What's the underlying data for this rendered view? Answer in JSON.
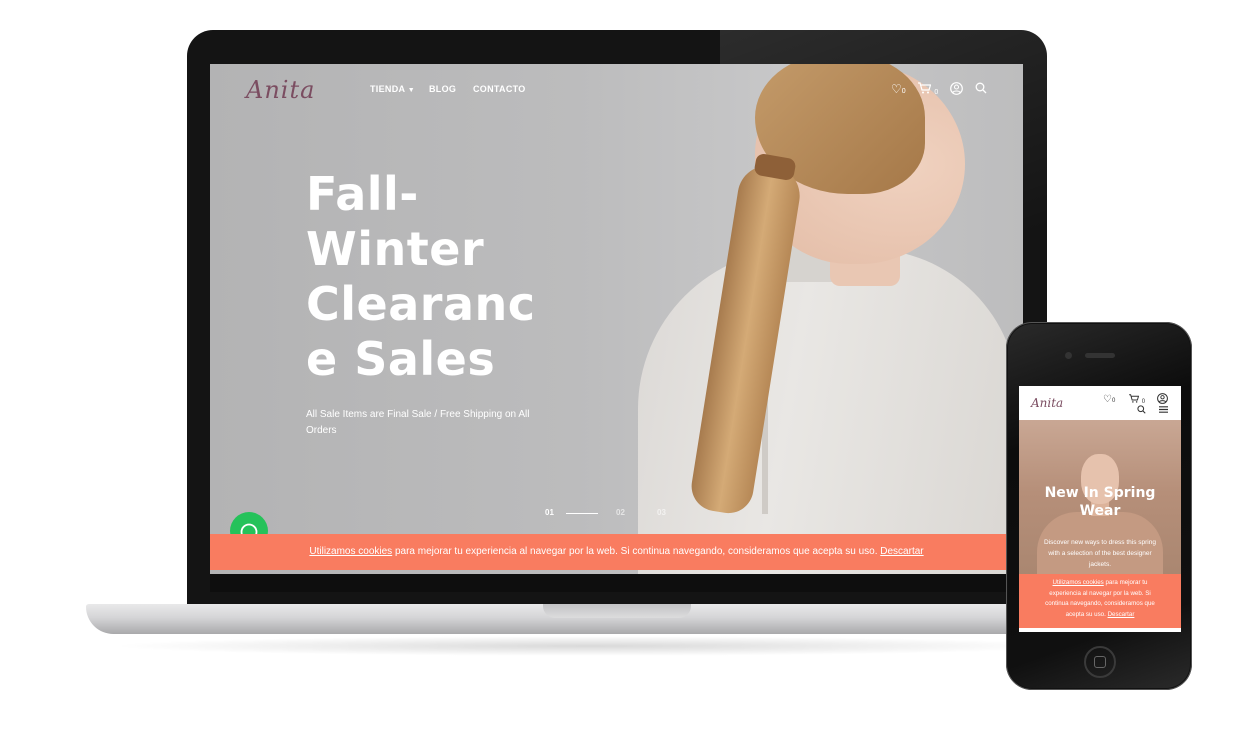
{
  "brand": {
    "logo_text": "Anita",
    "accent_color": "#7b4d61",
    "cookie_color": "#f97c60",
    "whatsapp_color": "#25c25a"
  },
  "desktop": {
    "nav": {
      "items": [
        {
          "label": "TIENDA",
          "has_dropdown": true
        },
        {
          "label": "BLOG"
        },
        {
          "label": "CONTACTO"
        }
      ],
      "icons": [
        "heart-icon",
        "cart-icon",
        "user-icon",
        "search-icon"
      ],
      "wishlist_count": "0",
      "cart_count": "0"
    },
    "hero": {
      "title_lines": [
        "Fall-",
        "Winter",
        "Clearanc",
        "e Sales"
      ],
      "subtitle_lines": [
        "All Sale Items are Final Sale / Free Shipping on All",
        "Orders"
      ]
    },
    "slider": {
      "slides": [
        "01",
        "02",
        "03"
      ],
      "active": 1
    },
    "cookie": {
      "link_text": "Utilizamos cookies",
      "body": " para mejorar tu experiencia al navegar por la web. Si continua navegando, consideramos que acepta su uso. ",
      "dismiss": "Descartar"
    },
    "whatsapp_icon": "whatsapp-icon"
  },
  "mobile": {
    "logo_text": "Anita",
    "wishlist_count": "0",
    "cart_count": "0",
    "icons": [
      "heart-icon",
      "cart-icon",
      "user-icon",
      "search-icon",
      "menu-icon"
    ],
    "hero": {
      "title_lines": [
        "New In Spring",
        "Wear"
      ],
      "subtitle_lines": [
        "Discover new ways to dress this spring",
        "with a selection of the best designer",
        "jackets."
      ]
    },
    "cookie": {
      "link_text": "Utilizamos cookies",
      "lines": [
        " para mejorar tu",
        "experiencia al navegar por la web. Si",
        "continua navegando, consideramos que",
        "acepta su uso. "
      ],
      "dismiss": "Descartar"
    }
  }
}
